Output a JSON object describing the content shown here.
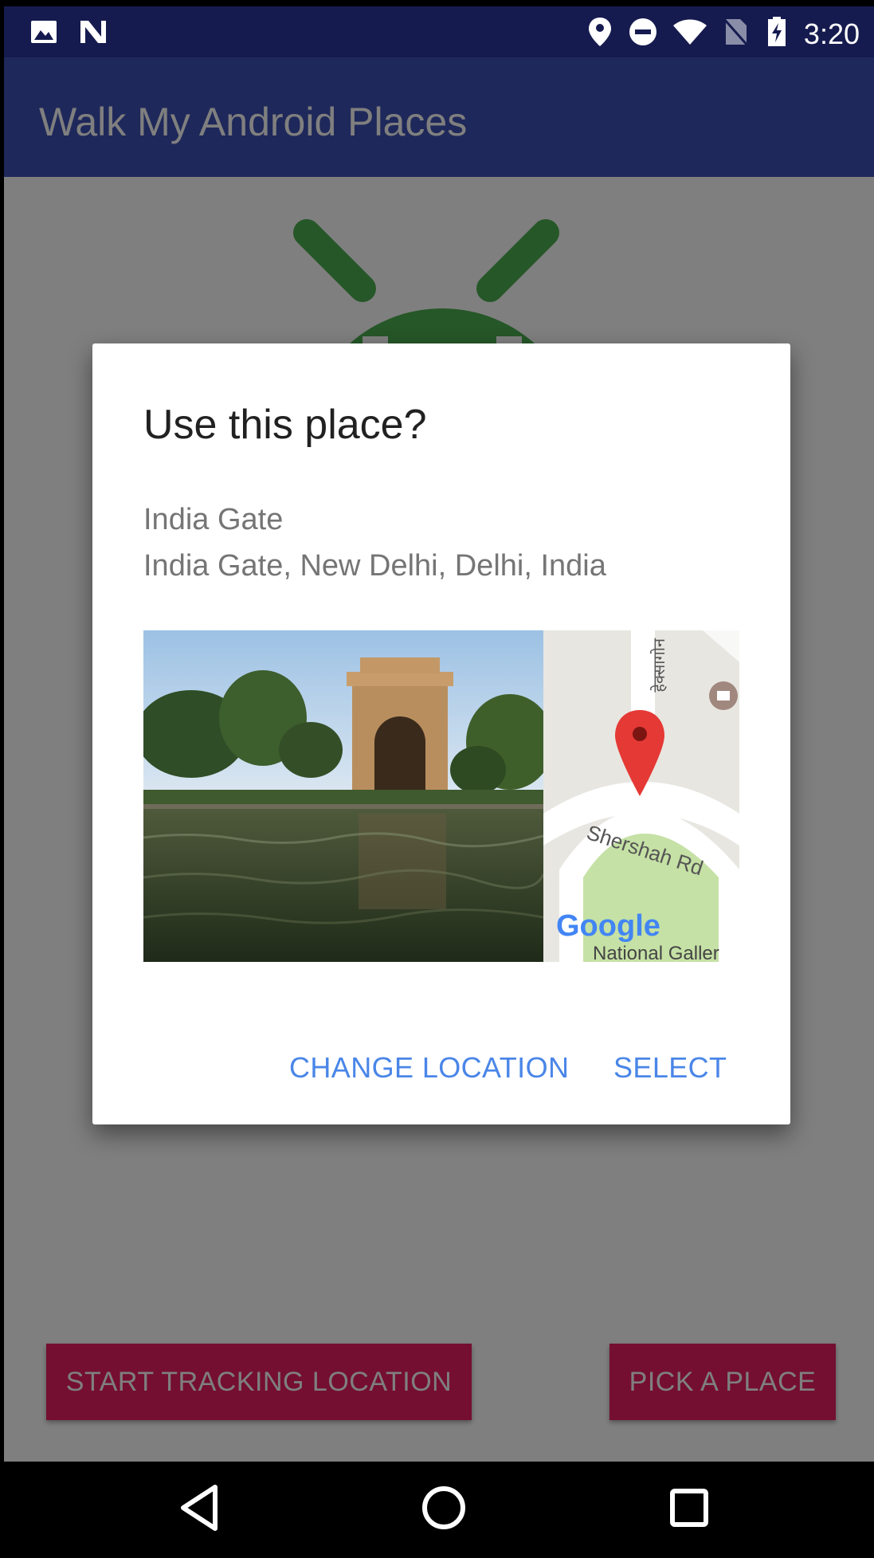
{
  "status_bar": {
    "time": "3:20",
    "icons": [
      "image-icon",
      "n-logo-icon",
      "location-pin-icon",
      "do-not-disturb-icon",
      "wifi-icon",
      "no-sim-icon",
      "battery-charging-icon"
    ]
  },
  "app_bar": {
    "title": "Walk My Android Places"
  },
  "content": {
    "start_tracking_label": "START TRACKING LOCATION",
    "pick_place_label": "PICK A PLACE",
    "accent_color": "#e91e63",
    "primary_color": "#3f51b5"
  },
  "dialog": {
    "title": "Use this place?",
    "place_name": "India Gate",
    "place_address": "India Gate, New Delhi, Delhi, India",
    "map": {
      "road_label": "Shershah Rd",
      "vertical_label": "हेक्सागोन",
      "poi_label": "National Galler",
      "logo": "Google"
    },
    "actions": {
      "change_location": "CHANGE LOCATION",
      "select": "SELECT"
    }
  },
  "nav_bar": {
    "buttons": [
      "back-icon",
      "home-icon",
      "recents-icon"
    ]
  }
}
